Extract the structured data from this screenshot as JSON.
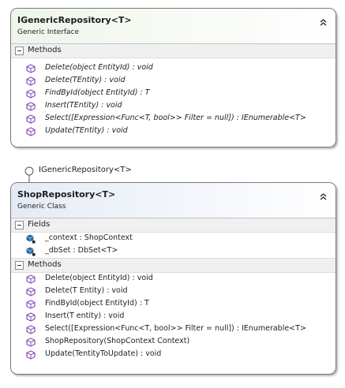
{
  "interface": {
    "title": "IGenericRepository<T>",
    "subtitle": "Generic Interface",
    "methods_label": "Methods",
    "methods": [
      "Delete(object EntityId) : void",
      "Delete(TEntity) : void",
      "FindById(object EntityId) : T",
      "Insert(TEntity) : void",
      "Select([Expression<Func<T, bool>> Filter = null]) : IEnumerable<T>",
      "Update(TEntity) : void"
    ]
  },
  "implements_label": "IGenericRepository<T>",
  "class": {
    "title": "ShopRepository<T>",
    "subtitle": "Generic Class",
    "fields_label": "Fields",
    "fields": [
      "_context : ShopContext",
      "_dbSet : DbSet<T>"
    ],
    "methods_label": "Methods",
    "methods": [
      "Delete(object EntityId) : void",
      "Delete(T Entity) : void",
      "FindById(object EntityId) : T",
      "Insert(T entity) : void",
      "Select([Expression<Func<T, bool>> Filter = null]) : IEnumerable<T>",
      "ShopRepository(ShopContext Context)",
      "Update(TentityToUpdate) : void"
    ]
  },
  "colors": {
    "method_icon": "#8a4fb8",
    "field_icon": "#2a6fa8",
    "interface_header": "#eef5ea",
    "class_header": "#e5ebf6"
  }
}
